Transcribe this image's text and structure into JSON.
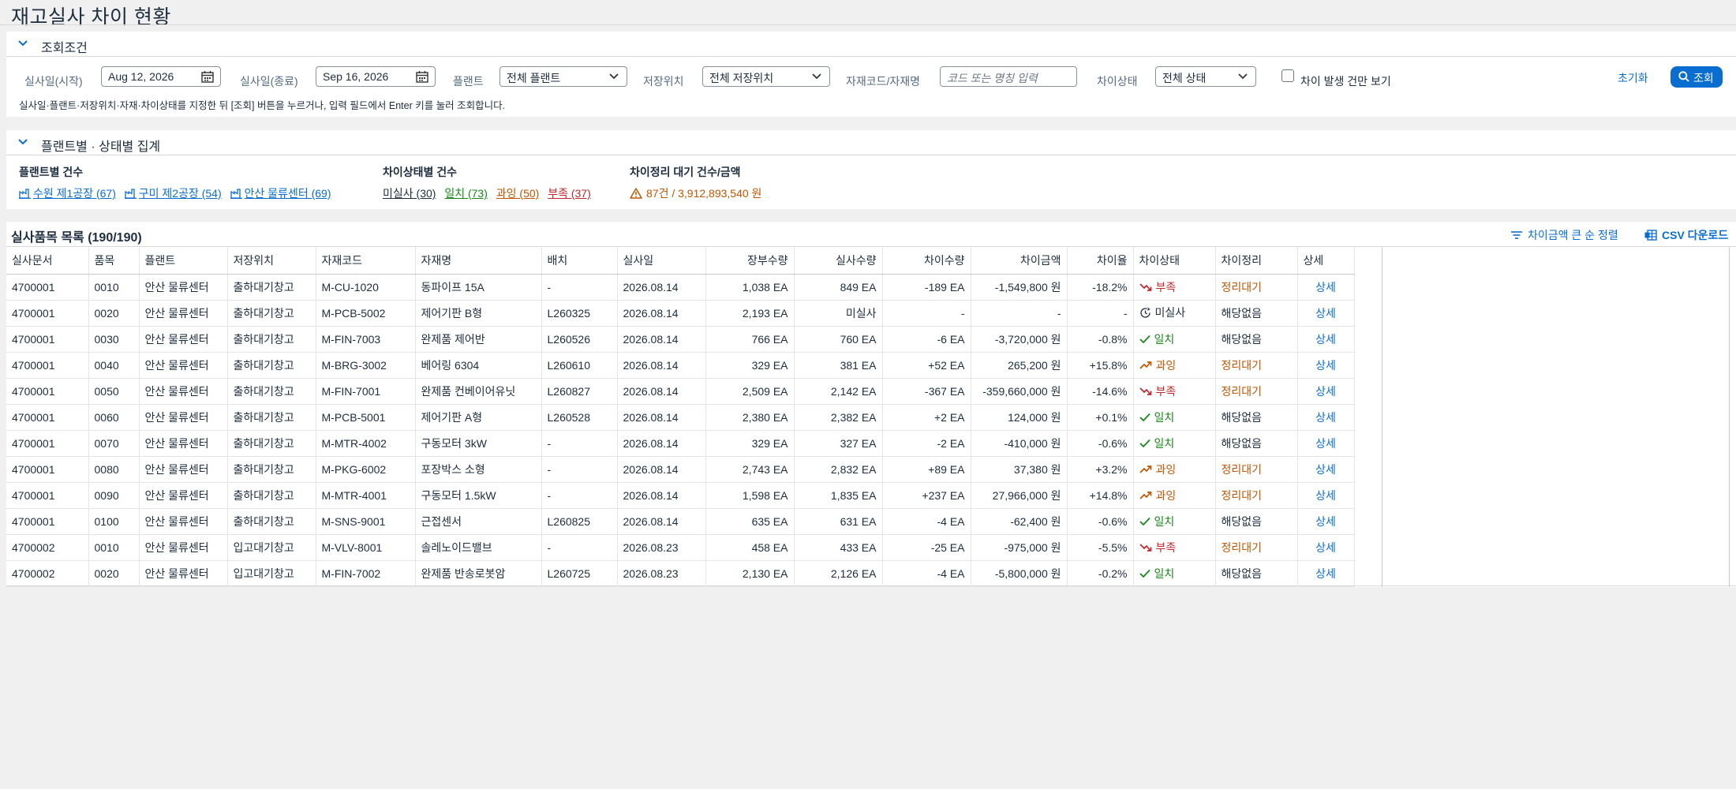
{
  "page": {
    "title": "재고실사 차이 현황"
  },
  "filter_panel": {
    "title": "조회조건",
    "start_label": "실사일(시작)",
    "start_value": "Aug 12, 2026",
    "end_label": "실사일(종료)",
    "end_value": "Sep 16, 2026",
    "plant_label": "플랜트",
    "plant_value": "전체 플랜트",
    "storage_label": "저장위치",
    "storage_value": "전체 저장위치",
    "material_label": "자재코드/자재명",
    "material_placeholder": "코드 또는 명칭 입력",
    "status_label": "차이상태",
    "status_value": "전체 상태",
    "only_diff_label": "차이 발생 건만 보기",
    "only_diff_checked": false,
    "reset_label": "초기화",
    "search_label": "조회",
    "hint": "실사일·플랜트·저장위치·자재·차이상태를 지정한 뒤 [조회] 버튼을 누르거나, 입력 필드에서 Enter 키를 눌러 조회합니다."
  },
  "summary_panel": {
    "title": "플랜트별 · 상태별 집계",
    "plants_title": "플랜트별 건수",
    "plants": [
      {
        "label": "수원 제1공장 (67)"
      },
      {
        "label": "구미 제2공장 (54)"
      },
      {
        "label": "안산 물류센터 (69)"
      }
    ],
    "status_title": "차이상태별 건수",
    "statuses": [
      {
        "label": "미실사 (30)"
      },
      {
        "label": "일치 (73)"
      },
      {
        "label": "과잉 (50)"
      },
      {
        "label": "부족 (37)"
      }
    ],
    "pending_title": "차이정리 대기 건수/금액",
    "pending_value": "87건 / 3,912,893,540 원"
  },
  "table": {
    "title": "실사품목 목록 (190/190)",
    "sort_label": "차이금액 큰 순 정렬",
    "csv_label": "CSV 다운로드",
    "columns": [
      "실사문서",
      "품목",
      "플랜트",
      "저장위치",
      "자재코드",
      "자재명",
      "배치",
      "실사일",
      "장부수량",
      "실사수량",
      "차이수량",
      "차이금액",
      "차이율",
      "차이상태",
      "차이정리",
      "상세"
    ],
    "rows": [
      {
        "doc": "4700001",
        "item": "0010",
        "plant": "안산 물류센터",
        "sloc": "출하대기창고",
        "mat": "M-CU-1020",
        "name": "동파이프 15A",
        "batch": "-",
        "date": "2026.08.14",
        "book": "1,038 EA",
        "count": "849 EA",
        "diff": "-189 EA",
        "amount": "-1,549,800 원",
        "rate": "-18.2%",
        "status": "부족",
        "status_key": "short",
        "resolve": "정리대기",
        "detail": "상세"
      },
      {
        "doc": "4700001",
        "item": "0020",
        "plant": "안산 물류센터",
        "sloc": "출하대기창고",
        "mat": "M-PCB-5002",
        "name": "제어기판 B형",
        "batch": "L260325",
        "date": "2026.08.14",
        "book": "2,193 EA",
        "count": "미실사",
        "diff": "-",
        "amount": "-",
        "rate": "-",
        "status": "미실사",
        "status_key": "uncount",
        "resolve": "해당없음",
        "detail": "상세"
      },
      {
        "doc": "4700001",
        "item": "0030",
        "plant": "안산 물류센터",
        "sloc": "출하대기창고",
        "mat": "M-FIN-7003",
        "name": "완제품 제어반",
        "batch": "L260526",
        "date": "2026.08.14",
        "book": "766 EA",
        "count": "760 EA",
        "diff": "-6 EA",
        "amount": "-3,720,000 원",
        "rate": "-0.8%",
        "status": "일치",
        "status_key": "match",
        "resolve": "해당없음",
        "detail": "상세"
      },
      {
        "doc": "4700001",
        "item": "0040",
        "plant": "안산 물류센터",
        "sloc": "출하대기창고",
        "mat": "M-BRG-3002",
        "name": "베어링 6304",
        "batch": "L260610",
        "date": "2026.08.14",
        "book": "329 EA",
        "count": "381 EA",
        "diff": "+52 EA",
        "amount": "265,200 원",
        "rate": "+15.8%",
        "status": "과잉",
        "status_key": "over",
        "resolve": "정리대기",
        "detail": "상세"
      },
      {
        "doc": "4700001",
        "item": "0050",
        "plant": "안산 물류센터",
        "sloc": "출하대기창고",
        "mat": "M-FIN-7001",
        "name": "완제품 컨베이어유닛",
        "batch": "L260827",
        "date": "2026.08.14",
        "book": "2,509 EA",
        "count": "2,142 EA",
        "diff": "-367 EA",
        "amount": "-359,660,000 원",
        "rate": "-14.6%",
        "status": "부족",
        "status_key": "short",
        "resolve": "정리대기",
        "detail": "상세"
      },
      {
        "doc": "4700001",
        "item": "0060",
        "plant": "안산 물류센터",
        "sloc": "출하대기창고",
        "mat": "M-PCB-5001",
        "name": "제어기판 A형",
        "batch": "L260528",
        "date": "2026.08.14",
        "book": "2,380 EA",
        "count": "2,382 EA",
        "diff": "+2 EA",
        "amount": "124,000 원",
        "rate": "+0.1%",
        "status": "일치",
        "status_key": "match",
        "resolve": "해당없음",
        "detail": "상세"
      },
      {
        "doc": "4700001",
        "item": "0070",
        "plant": "안산 물류센터",
        "sloc": "출하대기창고",
        "mat": "M-MTR-4002",
        "name": "구동모터 3kW",
        "batch": "-",
        "date": "2026.08.14",
        "book": "329 EA",
        "count": "327 EA",
        "diff": "-2 EA",
        "amount": "-410,000 원",
        "rate": "-0.6%",
        "status": "일치",
        "status_key": "match",
        "resolve": "해당없음",
        "detail": "상세"
      },
      {
        "doc": "4700001",
        "item": "0080",
        "plant": "안산 물류센터",
        "sloc": "출하대기창고",
        "mat": "M-PKG-6002",
        "name": "포장박스 소형",
        "batch": "-",
        "date": "2026.08.14",
        "book": "2,743 EA",
        "count": "2,832 EA",
        "diff": "+89 EA",
        "amount": "37,380 원",
        "rate": "+3.2%",
        "status": "과잉",
        "status_key": "over",
        "resolve": "정리대기",
        "detail": "상세"
      },
      {
        "doc": "4700001",
        "item": "0090",
        "plant": "안산 물류센터",
        "sloc": "출하대기창고",
        "mat": "M-MTR-4001",
        "name": "구동모터 1.5kW",
        "batch": "-",
        "date": "2026.08.14",
        "book": "1,598 EA",
        "count": "1,835 EA",
        "diff": "+237 EA",
        "amount": "27,966,000 원",
        "rate": "+14.8%",
        "status": "과잉",
        "status_key": "over",
        "resolve": "정리대기",
        "detail": "상세"
      },
      {
        "doc": "4700001",
        "item": "0100",
        "plant": "안산 물류센터",
        "sloc": "출하대기창고",
        "mat": "M-SNS-9001",
        "name": "근접센서",
        "batch": "L260825",
        "date": "2026.08.14",
        "book": "635 EA",
        "count": "631 EA",
        "diff": "-4 EA",
        "amount": "-62,400 원",
        "rate": "-0.6%",
        "status": "일치",
        "status_key": "match",
        "resolve": "해당없음",
        "detail": "상세"
      },
      {
        "doc": "4700002",
        "item": "0010",
        "plant": "안산 물류센터",
        "sloc": "입고대기창고",
        "mat": "M-VLV-8001",
        "name": "솔레노이드밸브",
        "batch": "-",
        "date": "2026.08.23",
        "book": "458 EA",
        "count": "433 EA",
        "diff": "-25 EA",
        "amount": "-975,000 원",
        "rate": "-5.5%",
        "status": "부족",
        "status_key": "short",
        "resolve": "정리대기",
        "detail": "상세"
      },
      {
        "doc": "4700002",
        "item": "0020",
        "plant": "안산 물류센터",
        "sloc": "입고대기창고",
        "mat": "M-FIN-7002",
        "name": "완제품 반송로봇암",
        "batch": "L260725",
        "date": "2026.08.23",
        "book": "2,130 EA",
        "count": "2,126 EA",
        "diff": "-4 EA",
        "amount": "-5,800,000 원",
        "rate": "-0.2%",
        "status": "일치",
        "status_key": "match",
        "resolve": "해당없음",
        "detail": "상세"
      }
    ]
  },
  "colors": {
    "accent": "#0a6ed1",
    "short": "#c1272d",
    "match": "#188918",
    "over": "#c35500",
    "text": "#1d2d3e"
  }
}
